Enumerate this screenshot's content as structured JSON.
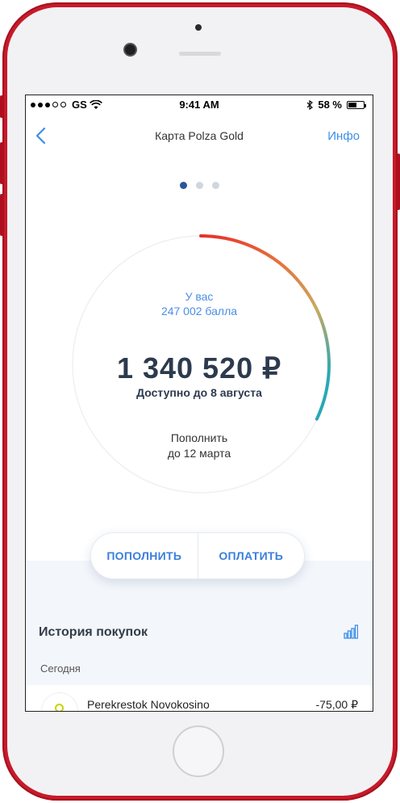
{
  "status": {
    "carrier": "GS",
    "time": "9:41 AM",
    "battery": "58 %",
    "battery_level": 0.58
  },
  "nav": {
    "back_icon": "chevron-left-icon",
    "title": "Карта Polza Gold",
    "info_label": "Инфо"
  },
  "pager": {
    "count": 3,
    "active_index": 0
  },
  "card": {
    "points_label": "У вас",
    "points_value": "247 002 балла",
    "balance": "1 340 520 ₽",
    "available_until": "Доступно до 8 августа",
    "topup_line1": "Пополнить",
    "topup_line2": "до 12 марта",
    "progress_fraction": 0.32,
    "gradient_colors": [
      "#e5322e",
      "#e66d3a",
      "#c9a95e",
      "#2aa8b5"
    ]
  },
  "actions": {
    "topup_label": "ПОПОЛНИТЬ",
    "pay_label": "ОПЛАТИТЬ"
  },
  "history": {
    "title": "История покупок",
    "chart_icon": "bar-chart-icon",
    "date_label": "Сегодня",
    "items": [
      {
        "merchant": "Perekrestok Novokosino",
        "amount": "-75,00 ₽"
      }
    ]
  },
  "colors": {
    "phone_body": "#c81a2a",
    "accent": "#3b8ee8",
    "dark_text": "#2c3a4e"
  }
}
